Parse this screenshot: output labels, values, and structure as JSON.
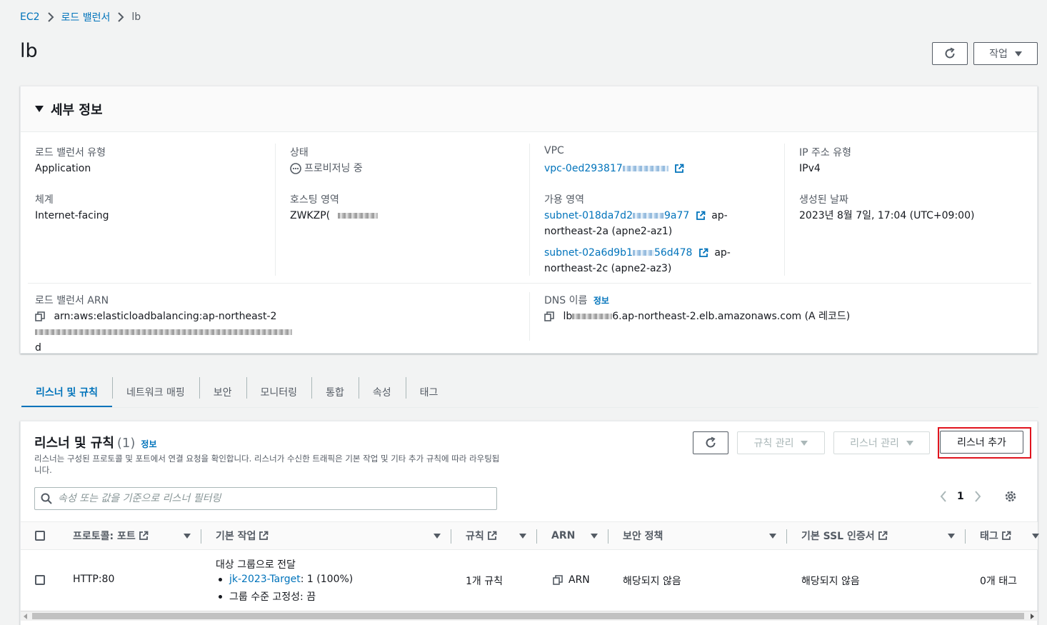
{
  "breadcrumb": {
    "ec2": "EC2",
    "lb_list": "로드 밸런서",
    "current": "lb"
  },
  "page_title": "lb",
  "header_actions": {
    "actions_label": "작업"
  },
  "details": {
    "title": "세부 정보",
    "lb_type_label": "로드 밸런서 유형",
    "lb_type_value": "Application",
    "state_label": "상태",
    "state_value": "프로비저닝 중",
    "vpc_label": "VPC",
    "vpc_value": "vpc-0ed293817",
    "ip_type_label": "IP 주소 유형",
    "ip_type_value": "IPv4",
    "scheme_label": "체계",
    "scheme_value": "Internet-facing",
    "hosted_zone_label": "호스팅 영역",
    "hosted_zone_value": "ZWKZP(",
    "az_label": "가용 영역",
    "az1_subnet_a": "subnet-018da7d2",
    "az1_subnet_b": "9a77",
    "az1_zone": "ap-northeast-2a (apne2-az1)",
    "az2_subnet_a": "subnet-02a6d9b1",
    "az2_subnet_b": "56d478",
    "az2_zone": "ap-northeast-2c (apne2-az3)",
    "created_label": "생성된 날짜",
    "created_value": "2023년 8월 7일, 17:04 (UTC+09:00)",
    "arn_label": "로드 밸런서 ARN",
    "arn_value": "arn:aws:elasticloadbalancing:ap-northeast-2",
    "arn_tail": "d",
    "dns_label": "DNS 이름",
    "dns_info": "정보",
    "dns_prefix": "lb",
    "dns_value": "6.ap-northeast-2.elb.amazonaws.com (A 레코드)"
  },
  "tabs": [
    {
      "label": "리스너 및 규칙",
      "active": true
    },
    {
      "label": "네트워크 매핑"
    },
    {
      "label": "보안"
    },
    {
      "label": "모니터링"
    },
    {
      "label": "통합"
    },
    {
      "label": "속성"
    },
    {
      "label": "태그"
    }
  ],
  "listeners": {
    "title": "리스너 및 규칙",
    "count": "(1)",
    "info": "정보",
    "description": "리스너는 구성된 프로토콜 및 포트에서 연결 요청을 확인합니다. 리스너가 수신한 트래픽은 기본 작업 및 기타 추가 규칙에 따라 라우팅됩니다.",
    "manage_rules": "규칙 관리",
    "manage_listener": "리스너 관리",
    "add_listener": "리스너 추가",
    "search_placeholder": "속성 또는 값을 기준으로 리스너 필터링",
    "page": "1",
    "columns": {
      "protocol_port": "프로토콜: 포트",
      "default_action": "기본 작업",
      "rules": "규칙",
      "arn": "ARN",
      "security_policy": "보안 정책",
      "ssl_cert": "기본 SSL 인증서",
      "tags": "태그"
    },
    "rows": [
      {
        "protocol_port": "HTTP:80",
        "action_title": "대상 그룹으로 전달",
        "target_link": "jk-2023-Target",
        "target_weight": ": 1 (100%)",
        "stickiness": "그룹 수준 고정성: 끔",
        "rules": "1개 규칙",
        "arn": "ARN",
        "security_policy": "해당되지 않음",
        "ssl_cert": "해당되지 않음",
        "tags": "0개 태그"
      }
    ]
  }
}
